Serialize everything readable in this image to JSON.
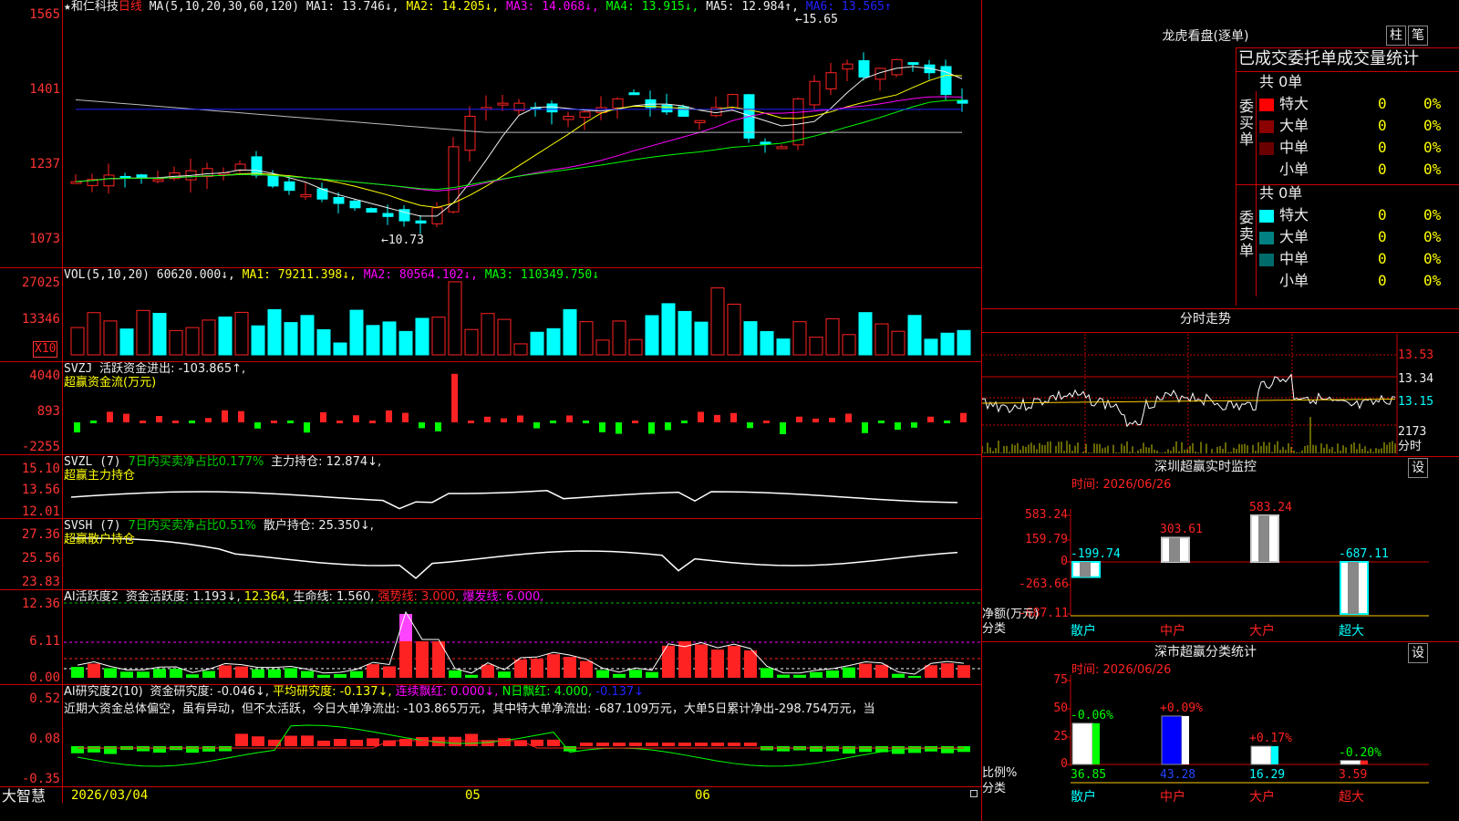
{
  "stock": {
    "star": "★",
    "name": "和仁科技",
    "period": "日线"
  },
  "price_panel": {
    "ma_params": "MA(5,10,20,30,60,120)",
    "ma_items": [
      {
        "label": "MA1: 13.746↓,",
        "color": "#eeeeee"
      },
      {
        "label": "MA2: 14.205↓,",
        "color": "#ffff00"
      },
      {
        "label": "MA3: 14.068↓,",
        "color": "#ff00ff"
      },
      {
        "label": "MA4: 13.915↓,",
        "color": "#00ff00"
      },
      {
        "label": "MA5: 12.984↑,",
        "color": "#eeeeee"
      },
      {
        "label": "MA6: 13.565↑",
        "color": "#2222ff"
      }
    ],
    "y_ticks": [
      "15.65",
      "14.01",
      "12.37",
      "10.73"
    ],
    "y_tick_shown": [
      "1565",
      "1401",
      "1237",
      "1073"
    ],
    "high_label": "←15.65",
    "low_label": "←10.73"
  },
  "vol_panel": {
    "title": "VOL(5,10,20)",
    "items": [
      {
        "label": "60620.000↓,",
        "color": "#eeeeee"
      },
      {
        "label": "MA1: 79211.398↓,",
        "color": "#ffff00"
      },
      {
        "label": "MA2: 80564.102↓,",
        "color": "#ff00ff"
      },
      {
        "label": "MA3: 110349.750↓",
        "color": "#00ff00"
      }
    ],
    "y_ticks": [
      "27025",
      "13346"
    ],
    "unit": "X10"
  },
  "svzj_panel": {
    "title": "SVZJ",
    "item": "活跃资金进出: -103.865↑,",
    "subtitle": "超赢资金流(万元)",
    "y_ticks": [
      "4040",
      "893",
      "-2255"
    ]
  },
  "svzl_panel": {
    "title": "SVZL (7)",
    "item1": "7日内买卖净占比0.177%",
    "item2": "主力持仓: 12.874↓,",
    "subtitle": "超赢主力持仓",
    "y_ticks": [
      "15.10",
      "13.56",
      "12.01"
    ]
  },
  "svsh_panel": {
    "title": "SVSH (7)",
    "item1": "7日内买卖净占比0.51%",
    "item2": "散户持仓: 25.350↓,",
    "subtitle": "超赢散户持仓",
    "y_ticks": [
      "27.36",
      "25.56",
      "23.83"
    ]
  },
  "ai_active_panel": {
    "title": "AI活跃度2",
    "items": [
      {
        "label": "资金活跃度: 1.193↓,",
        "color": "#eeeeee"
      },
      {
        "label": "12.364,",
        "color": "#ffff00"
      },
      {
        "label": "生命线: 1.560,",
        "color": "#eeeeee"
      },
      {
        "label": "强势线: 3.000,",
        "color": "#ff2222"
      },
      {
        "label": "爆发线: 6.000,",
        "color": "#ff00ff"
      }
    ],
    "y_ticks": [
      "12.36",
      "6.11",
      "0.00"
    ]
  },
  "ai_research_panel": {
    "title": "AI研究度2(10)",
    "items": [
      {
        "label": "资金研究度: -0.046↓,",
        "color": "#eeeeee"
      },
      {
        "label": "平均研究度: -0.137↓,",
        "color": "#ffff00"
      },
      {
        "label": "连续飘红: 0.000↓,",
        "color": "#ff00ff"
      },
      {
        "label": "N日飘红: 4.000,",
        "color": "#00ff00"
      },
      {
        "label": "-0.137↓",
        "color": "#2222ff"
      }
    ],
    "comment": "近期大资金总体偏空，虽有异动，但不太活跃，今日大单净流出: -103.865万元，其中特大单净流出: -687.109万元，大单5日累计净出-298.754万元，当",
    "y_ticks": [
      "0.52",
      "0.08",
      "-0.35"
    ]
  },
  "date_axis": {
    "start": "2026/03/04",
    "m1": "05",
    "m2": "06"
  },
  "brand": "大智慧",
  "right": {
    "dragon_title": "龙虎看盘(逐单)",
    "btn_zhu": "柱",
    "btn_bi": "笔",
    "order_header": "已成交委托单成交量统计",
    "buy": {
      "side": "委买单",
      "total": "共 0单",
      "rows": [
        {
          "label": "特大",
          "qty": "0",
          "pct": "0%",
          "color": "#ff0000"
        },
        {
          "label": "大单",
          "qty": "0",
          "pct": "0%",
          "color": "#8b0000"
        },
        {
          "label": "中单",
          "qty": "0",
          "pct": "0%",
          "color": "#6b0000"
        },
        {
          "label": "小单",
          "qty": "0",
          "pct": "0%",
          "color": "#000000"
        }
      ]
    },
    "sell": {
      "side": "委卖单",
      "total": "共 0单",
      "rows": [
        {
          "label": "特大",
          "qty": "0",
          "pct": "0%",
          "color": "#00ffff"
        },
        {
          "label": "大单",
          "qty": "0",
          "pct": "0%",
          "color": "#008080"
        },
        {
          "label": "中单",
          "qty": "0",
          "pct": "0%",
          "color": "#006b6b"
        },
        {
          "label": "小单",
          "qty": "0",
          "pct": "0%",
          "color": "#000000"
        }
      ]
    },
    "intraday_title": "分时走势",
    "intraday_ticks": [
      "13.53",
      "13.34",
      "13.15",
      "2173",
      "分时"
    ],
    "sz_monitor": {
      "title": "深圳超赢实时监控",
      "settings": "设",
      "time": "时间: 2026/06/26",
      "y_ticks": [
        "583.24",
        "159.79",
        "0",
        "-263.66",
        "-687.11"
      ],
      "axis_label": "净额(万元)",
      "cat_label": "分类",
      "categories": [
        "散户",
        "中户",
        "大户",
        "超大"
      ],
      "values": [
        -199.74,
        303.61,
        583.24,
        -687.11
      ],
      "value_labels": [
        "-199.74",
        "303.61",
        "583.24",
        "-687.11"
      ]
    },
    "sz_class": {
      "title": "深市超赢分类统计",
      "settings": "设",
      "time": "时间: 2026/06/26",
      "y_ticks": [
        "75",
        "50",
        "25",
        "0"
      ],
      "axis_label": "比例%",
      "cat_label": "分类",
      "categories": [
        "散户",
        "中户",
        "大户",
        "超大"
      ],
      "values": [
        36.85,
        43.28,
        16.29,
        3.59
      ],
      "value_labels": [
        "36.85",
        "43.28",
        "16.29",
        "3.59"
      ],
      "changes": [
        "-0.06%",
        "+0.09%",
        "+0.17%",
        "-0.20%"
      ]
    }
  }
}
